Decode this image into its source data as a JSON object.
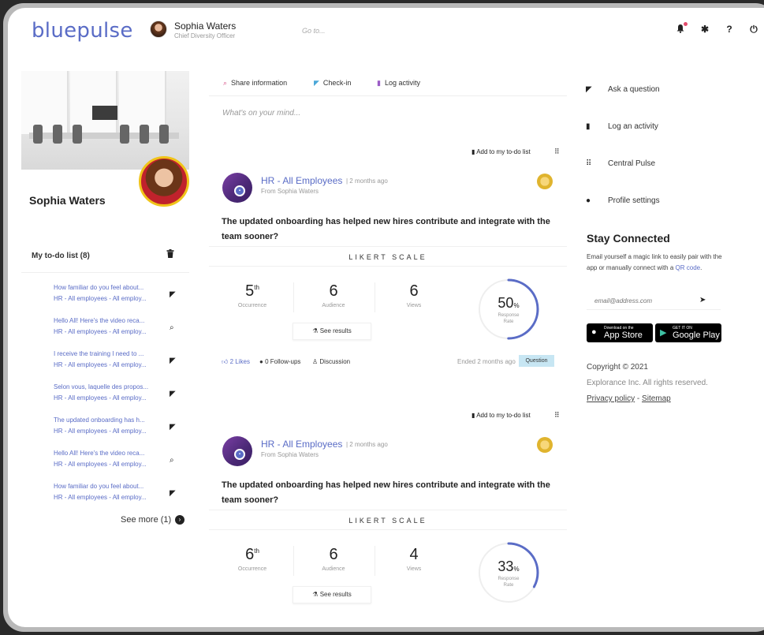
{
  "app": {
    "logo": "bluepulse"
  },
  "user": {
    "name": "Sophia Waters",
    "role": "Chief Diversity Officer"
  },
  "search": {
    "placeholder": "Go to..."
  },
  "top_icons": [
    "bell-icon",
    "gear-icon",
    "help-icon",
    "power-icon"
  ],
  "profile": {
    "name": "Sophia Waters"
  },
  "todo": {
    "header": "My to-do list (8)",
    "items": [
      {
        "title": "How familiar do you feel about...",
        "group": "HR - All employees - All employ...",
        "icon": "megaphone-icon"
      },
      {
        "title": "Hello All! Here's the video reca...",
        "group": "HR - All employees - All employ...",
        "icon": "share-icon"
      },
      {
        "title": "I receive the training I need to ...",
        "group": "HR - All employees - All employ...",
        "icon": "megaphone-icon"
      },
      {
        "title": "Selon vous, laquelle des propos...",
        "group": "HR - All employees - All employ...",
        "icon": "megaphone-icon"
      },
      {
        "title": "The updated onboarding has h...",
        "group": "HR - All employees - All employ...",
        "icon": "megaphone-icon"
      },
      {
        "title": "Hello All! Here's the video reca...",
        "group": "HR - All employees - All employ...",
        "icon": "share-icon"
      },
      {
        "title": "How familiar do you feel about...",
        "group": "HR - All employees - All employ...",
        "icon": "megaphone-icon"
      }
    ],
    "see_more": "See more (1)"
  },
  "composer": {
    "share": "Share information",
    "checkin": "Check-in",
    "log": "Log activity",
    "placeholder": "What's on your mind..."
  },
  "posts": [
    {
      "add_todo": "Add to my to-do list",
      "group": "HR - All Employees",
      "time": "| 2 months ago",
      "from": "From Sophia Waters",
      "question": "The updated onboarding has helped new hires contribute and integrate with the team sooner?",
      "scale": "LIKERT SCALE",
      "occurrence": "5",
      "occurrence_suffix": "th",
      "occurrence_label": "Occurrence",
      "audience": "6",
      "audience_label": "Audience",
      "views": "6",
      "views_label": "Views",
      "see_results": "See results",
      "rate": "50",
      "rate_pct": 50,
      "rate_unit": "%",
      "rate_label_1": "Response",
      "rate_label_2": "Rate",
      "likes": "2 Likes",
      "followups": "0 Follow-ups",
      "discussion": "Discussion",
      "ended": "Ended 2 months ago",
      "badge": "Question"
    },
    {
      "add_todo": "Add to my to-do list",
      "group": "HR - All Employees",
      "time": "| 2 months ago",
      "from": "From Sophia Waters",
      "question": "The updated onboarding has helped new hires contribute and integrate with the team sooner?",
      "scale": "LIKERT SCALE",
      "occurrence": "6",
      "occurrence_suffix": "th",
      "occurrence_label": "Occurrence",
      "audience": "6",
      "audience_label": "Audience",
      "views": "4",
      "views_label": "Views",
      "see_results": "See results",
      "rate": "33",
      "rate_pct": 33,
      "rate_unit": "%",
      "rate_label_1": "Response",
      "rate_label_2": "Rate"
    }
  ],
  "right_menu": [
    {
      "label": "Ask a question",
      "icon": "megaphone-icon"
    },
    {
      "label": "Log an activity",
      "icon": "document-icon"
    },
    {
      "label": "Central Pulse",
      "icon": "grid-icon"
    },
    {
      "label": "Profile settings",
      "icon": "user-icon"
    }
  ],
  "stay_connected": {
    "title": "Stay Connected",
    "text_1": "Email yourself a magic link to easily pair with the app or manually connect with a",
    "qr_link": "QR code",
    "text_end": ".",
    "email_placeholder": "email@address.com",
    "app_store_small": "Download on the",
    "app_store_big": "App Store",
    "google_small": "GET IT ON",
    "google_big": "Google Play"
  },
  "footer": {
    "copyright": "Copyright © 2021",
    "rights": "Explorance Inc. All rights reserved.",
    "privacy": "Privacy policy",
    "separator": "-",
    "sitemap": "Sitemap"
  },
  "colors": {
    "accent": "#5a6cc6",
    "badge": "#c7e6f3",
    "ring": "#5a6cc6"
  }
}
